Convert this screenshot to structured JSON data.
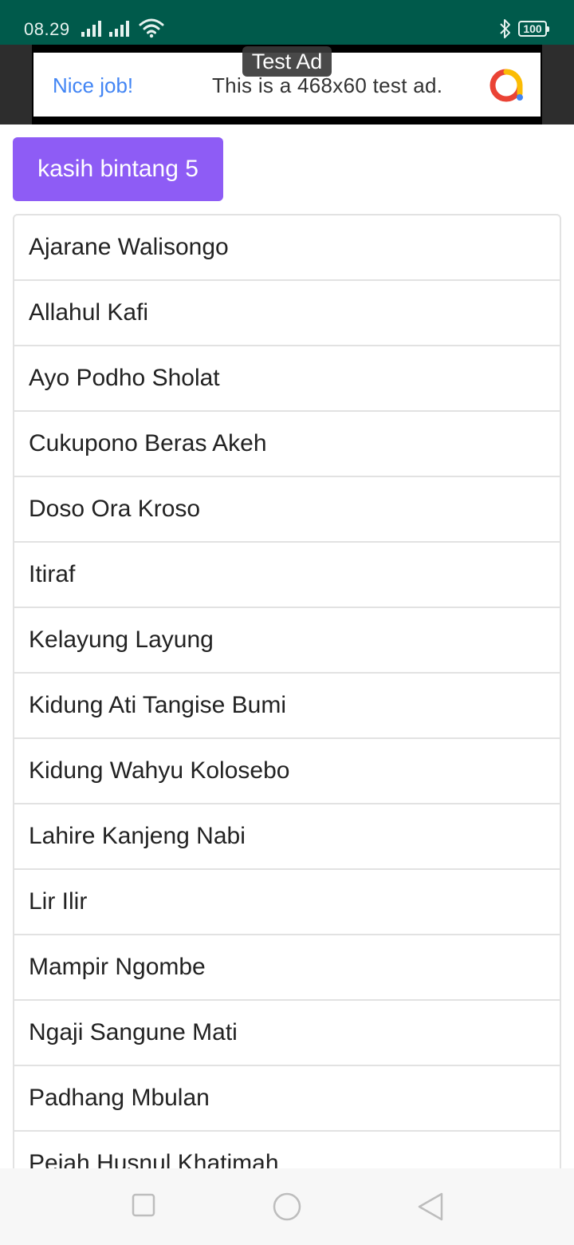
{
  "status_bar": {
    "time": "08.29",
    "battery": "100",
    "icons": [
      "signal-icon",
      "signal-icon",
      "wifi-icon",
      "bluetooth-icon",
      "battery-icon"
    ]
  },
  "ad": {
    "label": "Test Ad",
    "headline": "Nice job!",
    "body": "This is a 468x60 test ad.",
    "logo": "admob-logo-icon",
    "colors": {
      "headline": "#4285f4"
    }
  },
  "rate_button": {
    "label": "kasih bintang 5",
    "color": "#8e5cf5"
  },
  "songs": [
    "Ajarane Walisongo",
    "Allahul Kafi",
    "Ayo Podho Sholat",
    "Cukupono Beras Akeh",
    "Doso Ora Kroso",
    "Itiraf",
    "Kelayung Layung",
    "Kidung Ati Tangise Bumi",
    "Kidung Wahyu Kolosebo",
    "Lahire Kanjeng Nabi",
    "Lir Ilir",
    "Mampir Ngombe",
    "Ngaji Sangune Mati",
    "Padhang Mbulan",
    "Pejah Husnul Khatimah"
  ],
  "nav_bar": {
    "icons": [
      "recent-apps-icon",
      "home-icon",
      "back-icon"
    ]
  },
  "colors": {
    "status_bar": "#005a4b",
    "ad_background": "#2d2d2d"
  }
}
